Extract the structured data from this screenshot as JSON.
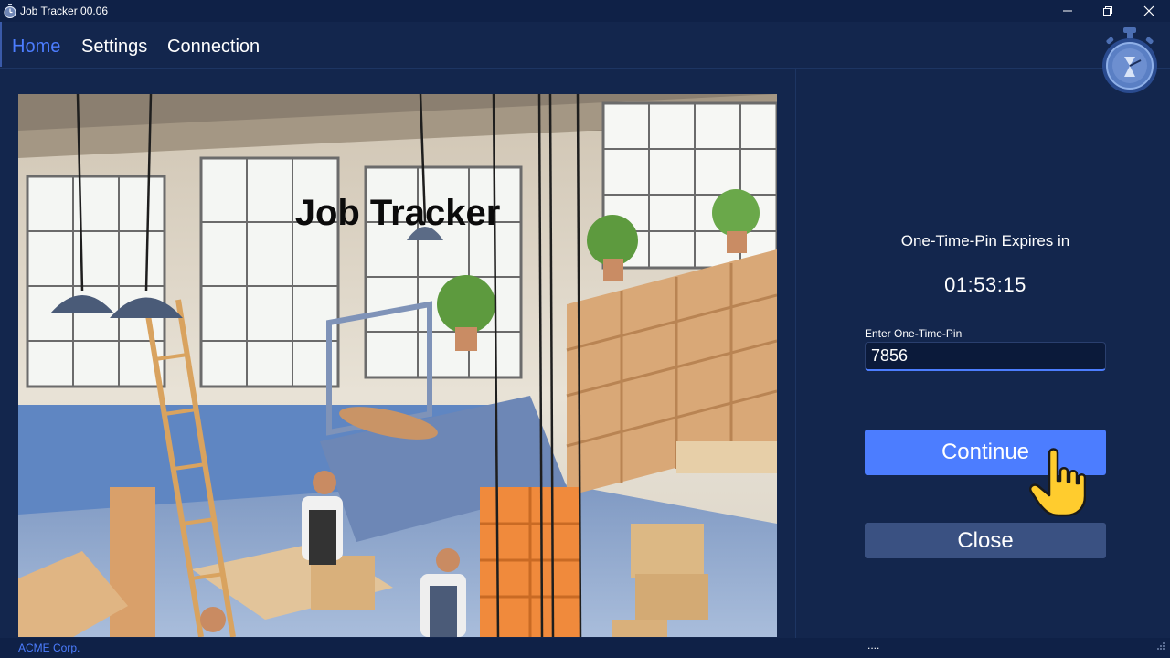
{
  "window": {
    "title": "Job Tracker 00.06",
    "icon": "stopwatch-icon",
    "controls": [
      "minimize-icon",
      "restore-icon",
      "close-icon"
    ]
  },
  "nav": {
    "tabs": [
      {
        "label": "Home",
        "active": true
      },
      {
        "label": "Settings",
        "active": false
      },
      {
        "label": "Connection",
        "active": false
      }
    ],
    "logo_icon": "stopwatch-icon"
  },
  "hero": {
    "title": "Job Tracker"
  },
  "otp": {
    "expires_label": "One-Time-Pin Expires in",
    "countdown": "01:53:15",
    "field_label": "Enter One-Time-Pin",
    "value": "7856"
  },
  "actions": {
    "continue_label": "Continue",
    "close_label": "Close"
  },
  "status": {
    "company": "ACME Corp.",
    "indicator": "...."
  },
  "colors": {
    "background": "#13264d",
    "titlebar": "#0f2147",
    "accent": "#4c7dff",
    "secondary_button": "#3a5182"
  }
}
